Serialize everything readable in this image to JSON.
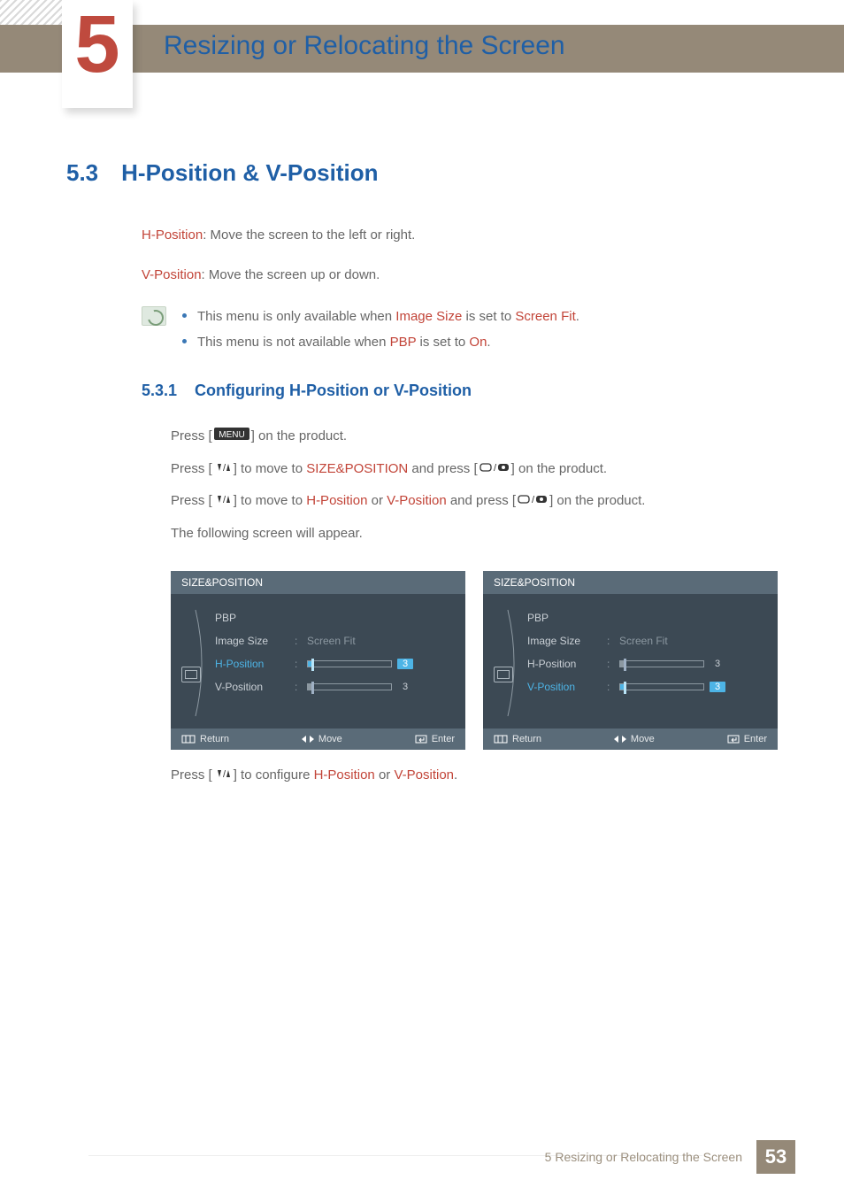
{
  "chapter": {
    "number": "5",
    "title": "Resizing or Relocating the Screen"
  },
  "section": {
    "number": "5.3",
    "title": "H-Position & V-Position"
  },
  "descriptions": {
    "h_label": "H-Position",
    "h_text": ": Move the screen to the left or right.",
    "v_label": "V-Position",
    "v_text": ": Move the screen up or down."
  },
  "notes": [
    {
      "pre": "This menu is only available when ",
      "bold1": "Image Size",
      "mid": " is set to ",
      "bold2": "Screen Fit",
      "post": "."
    },
    {
      "pre": "This menu is not available when ",
      "bold1": "PBP",
      "mid": " is set to ",
      "bold2": "On",
      "post": "."
    }
  ],
  "subsection": {
    "number": "5.3.1",
    "title": "Configuring H-Position or V-Position"
  },
  "steps": {
    "s0a": "Press [",
    "s0b": "] on the product.",
    "s1a": "Press [",
    "s1b": "] to move to ",
    "s1c": "SIZE&POSITION",
    "s1d": " and press [",
    "s1e": "] on the product.",
    "s2a": "Press [",
    "s2b": "] to move to ",
    "s2c": "H-Position",
    "s2d": " or ",
    "s2e": "V-Position",
    "s2f": " and press [",
    "s2g": "] on the product.",
    "s3": "The following screen will appear."
  },
  "osd": {
    "title": "SIZE&POSITION",
    "rows": {
      "pbp": "PBP",
      "image_size": "Image Size",
      "image_size_val": "Screen Fit",
      "h": "H-Position",
      "v": "V-Position"
    },
    "value": "3",
    "footer": {
      "return": "Return",
      "move": "Move",
      "enter": "Enter"
    }
  },
  "after_osd": {
    "a": "Press [",
    "b": "] to configure ",
    "c": "H-Position",
    "d": " or ",
    "e": "V-Position",
    "f": "."
  },
  "footer": {
    "text": "5 Resizing or Relocating the Screen",
    "page": "53"
  },
  "icons": {
    "menu": "MENU"
  }
}
